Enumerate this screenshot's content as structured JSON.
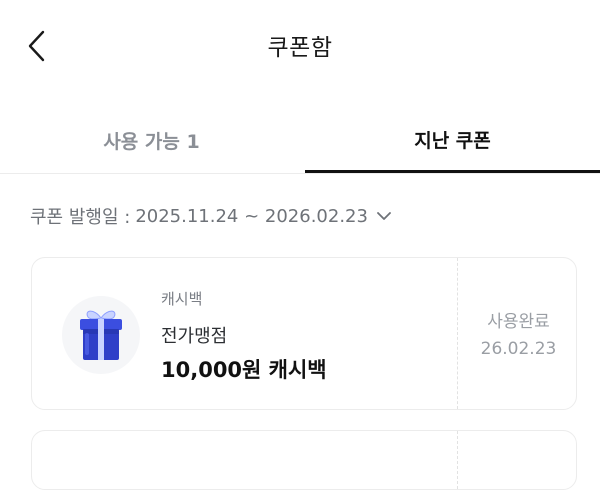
{
  "header": {
    "title": "쿠폰함"
  },
  "tabs": [
    {
      "label": "사용 가능 1",
      "active": false
    },
    {
      "label": "지난 쿠폰",
      "active": true
    }
  ],
  "filter": {
    "prefix": "쿠폰 발행일 :",
    "range": "2025.11.24 ~ 2026.02.23"
  },
  "coupons": [
    {
      "category": "캐시백",
      "store": "전가맹점",
      "amount": "10,000원 캐시백",
      "status": "사용완료",
      "date": "26.02.23",
      "icon": "gift-icon"
    }
  ],
  "colors": {
    "gift_blue": "#2f3fc8",
    "gift_ribbon": "#c9d3ff",
    "active_tab": "#111111",
    "inactive_tab": "#8b8f96"
  }
}
